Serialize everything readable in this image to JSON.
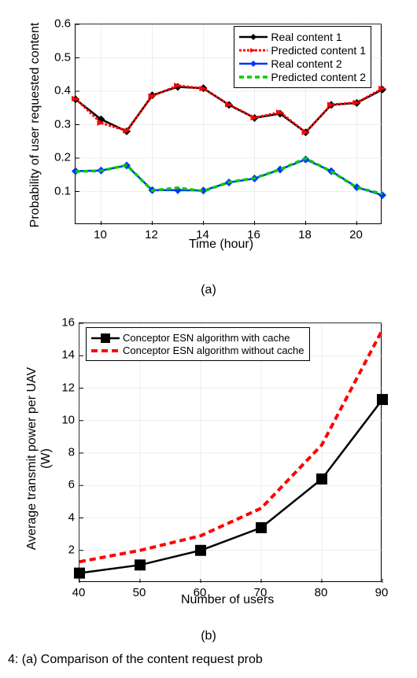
{
  "chart_data": [
    {
      "id": "a",
      "type": "line",
      "xlabel": "Time (hour)",
      "ylabel": "Probability of user requested content",
      "xlim": [
        9,
        21
      ],
      "ylim": [
        0,
        0.6
      ],
      "xticks": [
        10,
        12,
        14,
        16,
        18,
        20
      ],
      "yticks": [
        0.1,
        0.2,
        0.3,
        0.4,
        0.5,
        0.6
      ],
      "x": [
        9,
        10,
        11,
        12,
        13,
        14,
        15,
        16,
        17,
        18,
        19,
        20,
        21
      ],
      "series": [
        {
          "name": "Real content 1",
          "color": "#000000",
          "marker": "diamond",
          "dash": "none",
          "width": 2.5,
          "values": [
            0.376,
            0.316,
            0.28,
            0.388,
            0.413,
            0.409,
            0.359,
            0.32,
            0.333,
            0.277,
            0.359,
            0.365,
            0.405
          ]
        },
        {
          "name": "Predicted content 1",
          "color": "#ff0000",
          "marker": "arrow",
          "dash": "3,2",
          "width": 3,
          "values": [
            0.378,
            0.305,
            0.282,
            0.386,
            0.417,
            0.408,
            0.36,
            0.321,
            0.337,
            0.277,
            0.36,
            0.366,
            0.408
          ]
        },
        {
          "name": "Real content 2",
          "color": "#0033ff",
          "marker": "diamond",
          "dash": "none",
          "width": 2.5,
          "values": [
            0.161,
            0.163,
            0.178,
            0.104,
            0.104,
            0.103,
            0.127,
            0.139,
            0.166,
            0.196,
            0.161,
            0.113,
            0.089
          ]
        },
        {
          "name": "Predicted content 2",
          "color": "#00cc00",
          "marker": "none",
          "dash": "6,4",
          "width": 3.5,
          "values": [
            0.16,
            0.162,
            0.179,
            0.103,
            0.111,
            0.101,
            0.128,
            0.14,
            0.166,
            0.199,
            0.16,
            0.112,
            0.093
          ]
        }
      ],
      "sub_label": "(a)"
    },
    {
      "id": "b",
      "type": "line",
      "xlabel": "Number of users",
      "ylabel": "Average transmit power per UAV (W)",
      "xlim": [
        40,
        90
      ],
      "ylim": [
        0,
        16
      ],
      "xticks": [
        40,
        50,
        60,
        70,
        80,
        90
      ],
      "yticks": [
        2,
        4,
        6,
        8,
        10,
        12,
        14,
        16
      ],
      "x": [
        40,
        50,
        60,
        70,
        80,
        90
      ],
      "series": [
        {
          "name": "Conceptor ESN algorithm with cache",
          "color": "#000000",
          "marker": "square",
          "dash": "none",
          "width": 2.5,
          "values": [
            0.6,
            1.1,
            2.0,
            3.4,
            6.4,
            11.3
          ]
        },
        {
          "name": "Conceptor ESN algorithm without cache",
          "color": "#ff0000",
          "marker": "none",
          "dash": "8,5",
          "width": 4,
          "values": [
            1.3,
            2.0,
            2.9,
            4.6,
            8.5,
            15.6
          ]
        }
      ],
      "sub_label": "(b)"
    }
  ],
  "caption_fragment": "4:  (a) Comparison of the content request prob"
}
